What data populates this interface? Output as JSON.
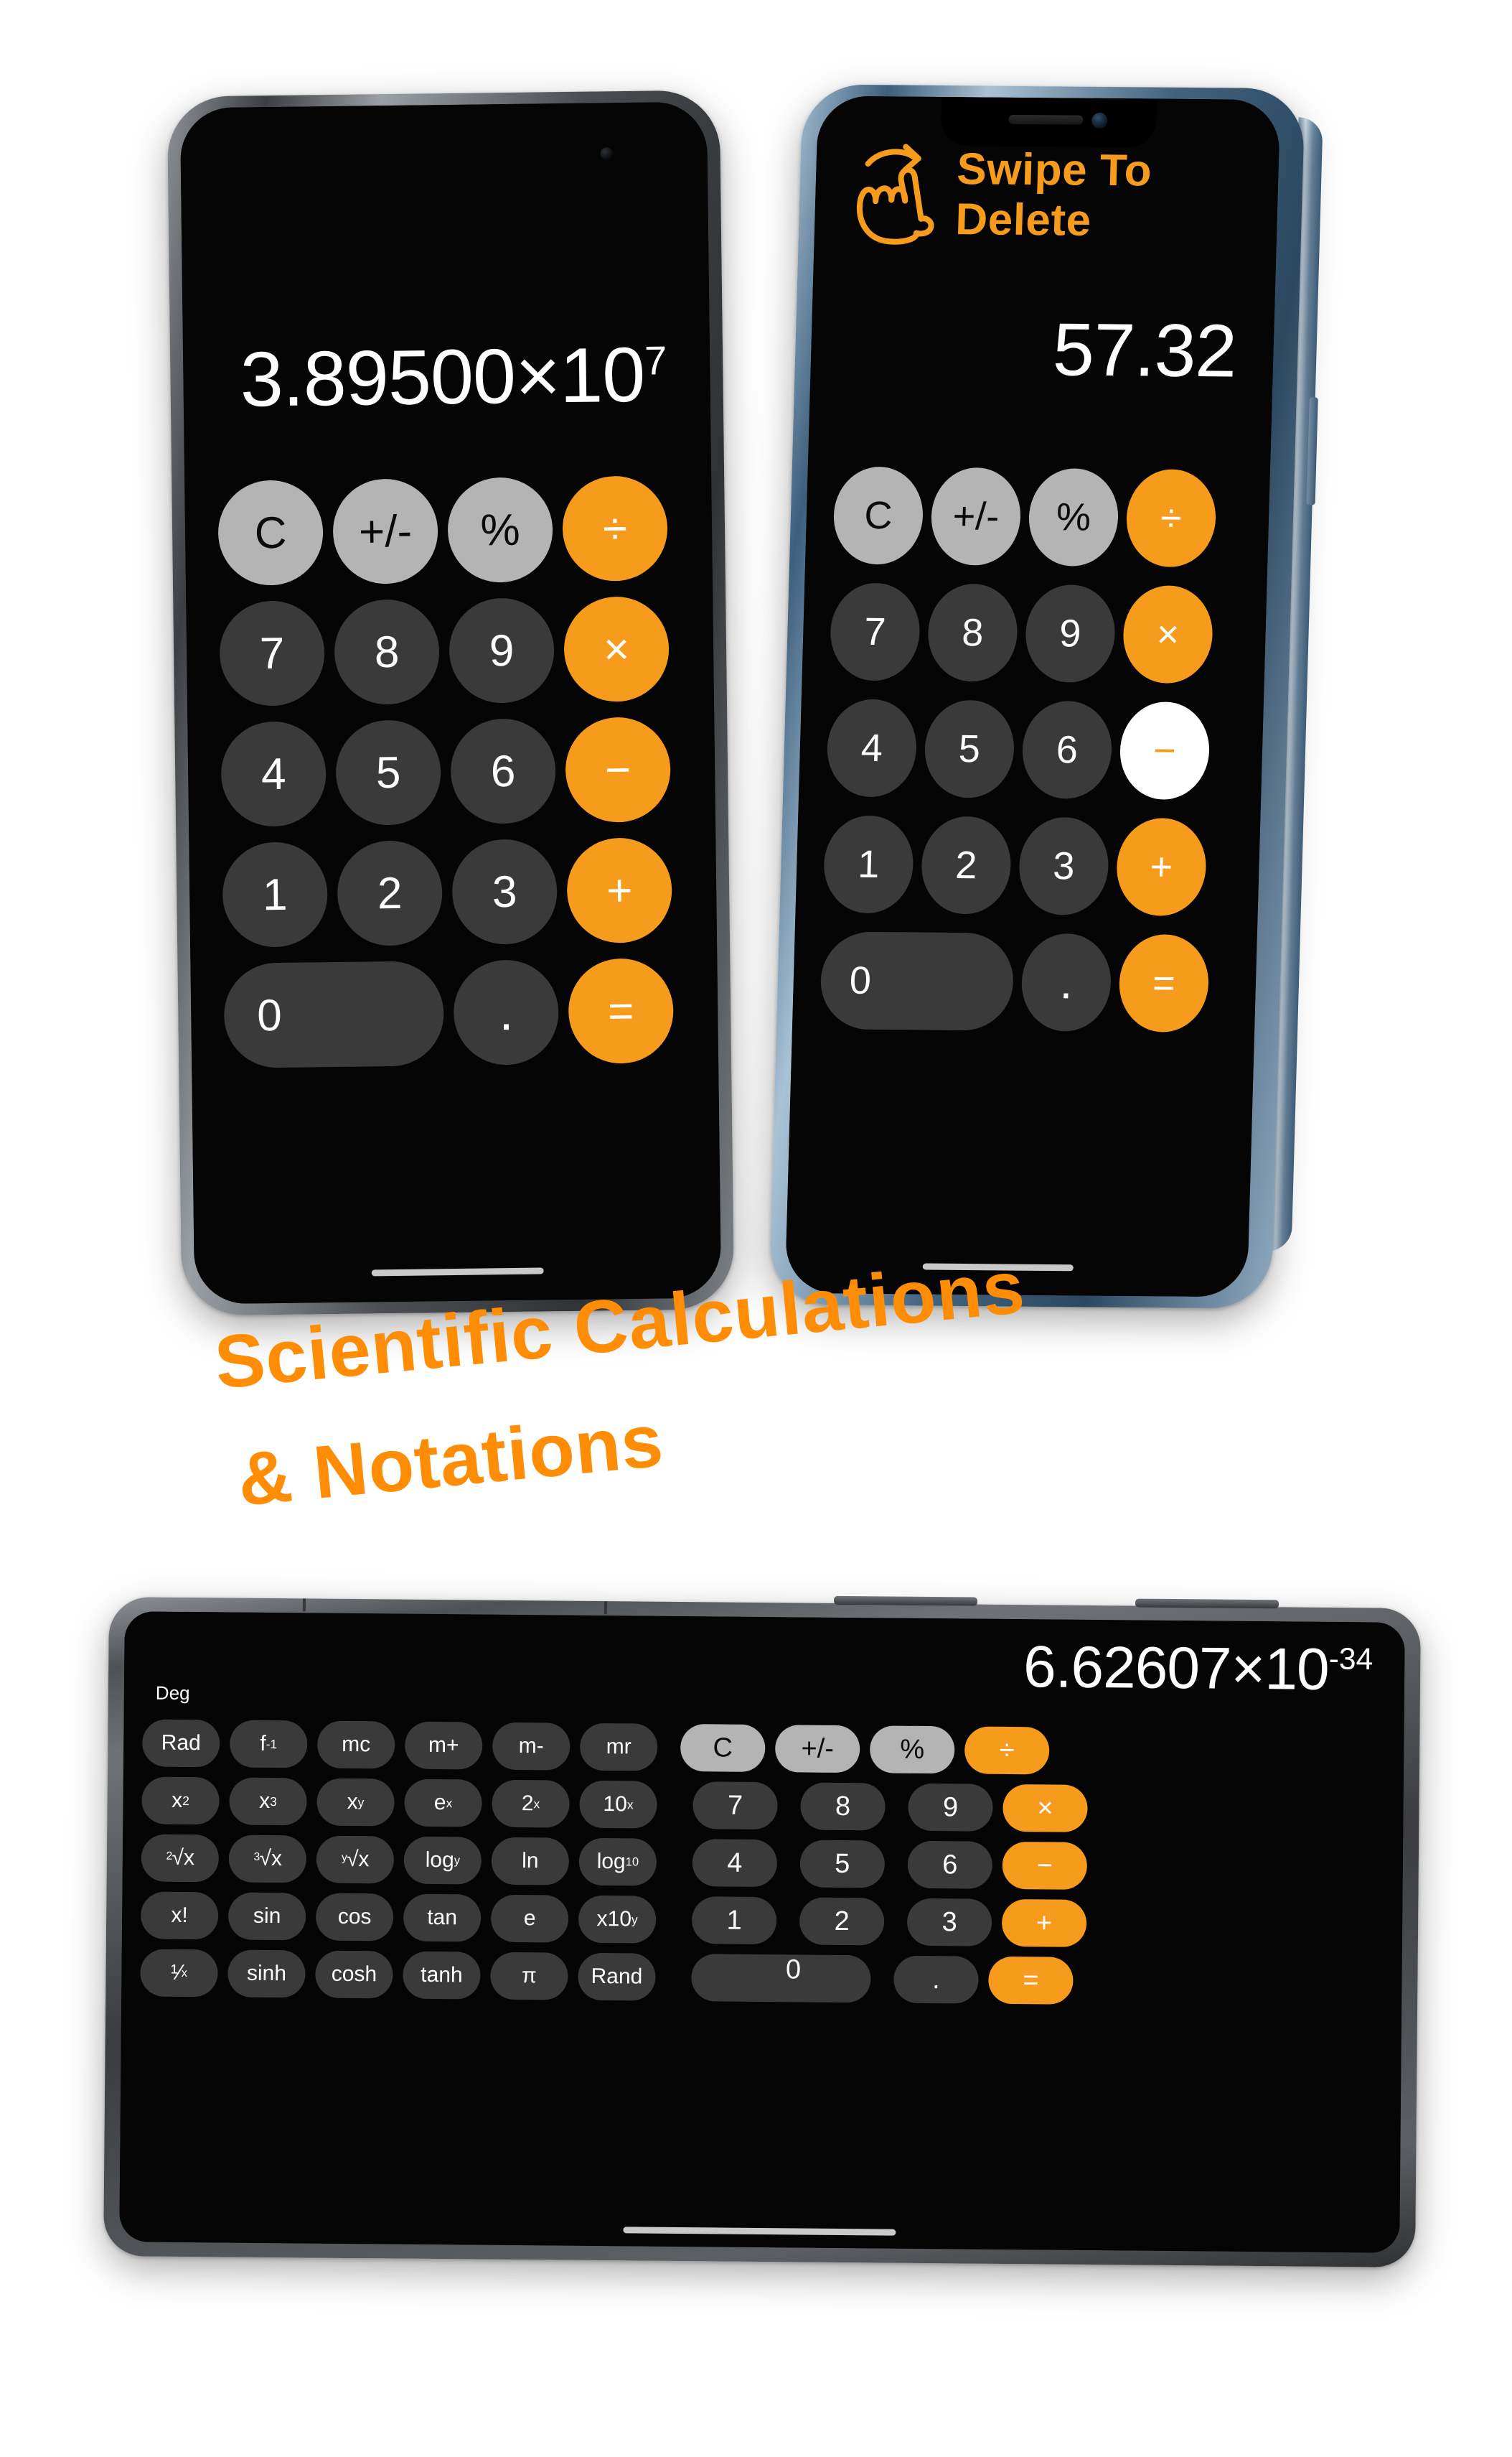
{
  "page": {
    "background_color": "#ffffff",
    "accent_color": "#f79b1c",
    "headline_color": "#ff8c05"
  },
  "headline": {
    "line1": "Scientific Calculations",
    "line2": "& Notations"
  },
  "phone_one": {
    "device": "smartphone-graphite",
    "display_value": "3.89500×10",
    "display_exponent": "7",
    "keys": [
      [
        {
          "label": "C",
          "style": "top"
        },
        {
          "label": "+/-",
          "style": "top"
        },
        {
          "label": "%",
          "style": "top"
        },
        {
          "label": "÷",
          "style": "op"
        }
      ],
      [
        {
          "label": "7",
          "style": "num"
        },
        {
          "label": "8",
          "style": "num"
        },
        {
          "label": "9",
          "style": "num"
        },
        {
          "label": "×",
          "style": "op"
        }
      ],
      [
        {
          "label": "4",
          "style": "num"
        },
        {
          "label": "5",
          "style": "num"
        },
        {
          "label": "6",
          "style": "num"
        },
        {
          "label": "−",
          "style": "op"
        }
      ],
      [
        {
          "label": "1",
          "style": "num"
        },
        {
          "label": "2",
          "style": "num"
        },
        {
          "label": "3",
          "style": "num"
        },
        {
          "label": "+",
          "style": "op"
        }
      ],
      [
        {
          "label": "0",
          "style": "zero"
        },
        {
          "label": ".",
          "style": "dot"
        },
        {
          "label": "=",
          "style": "op"
        }
      ]
    ]
  },
  "phone_two": {
    "device": "smartphone-sierra-blue",
    "banner_text_line1": "Swipe To",
    "banner_text_line2": "Delete",
    "banner_icon": "swipe-hand-icon",
    "display_value": "57.32",
    "active_operator": "−",
    "keys": [
      [
        {
          "label": "C",
          "style": "top"
        },
        {
          "label": "+/-",
          "style": "top"
        },
        {
          "label": "%",
          "style": "top"
        },
        {
          "label": "÷",
          "style": "op"
        }
      ],
      [
        {
          "label": "7",
          "style": "num"
        },
        {
          "label": "8",
          "style": "num"
        },
        {
          "label": "9",
          "style": "num"
        },
        {
          "label": "×",
          "style": "op"
        }
      ],
      [
        {
          "label": "4",
          "style": "num"
        },
        {
          "label": "5",
          "style": "num"
        },
        {
          "label": "6",
          "style": "num"
        },
        {
          "label": "−",
          "style": "op-active"
        }
      ],
      [
        {
          "label": "1",
          "style": "num"
        },
        {
          "label": "2",
          "style": "num"
        },
        {
          "label": "3",
          "style": "num"
        },
        {
          "label": "+",
          "style": "op"
        }
      ],
      [
        {
          "label": "0",
          "style": "zero"
        },
        {
          "label": ".",
          "style": "dot"
        },
        {
          "label": "=",
          "style": "op"
        }
      ]
    ]
  },
  "tablet": {
    "device": "tablet-landscape",
    "angle_mode": "Deg",
    "display_value": "6.62607×10",
    "display_exponent": "-34",
    "scientific_keys": [
      [
        {
          "label": "Rad"
        },
        {
          "label": "f",
          "sup": "-1"
        },
        {
          "label": "mc"
        },
        {
          "label": "m+"
        },
        {
          "label": "m-"
        },
        {
          "label": "mr"
        }
      ],
      [
        {
          "label": "x",
          "sup": "2"
        },
        {
          "label": "x",
          "sup": "3"
        },
        {
          "label": "x",
          "sup": "y"
        },
        {
          "label": "e",
          "sup": "x"
        },
        {
          "label": "2",
          "sup": "x"
        },
        {
          "label": "10",
          "sup": "x"
        }
      ],
      [
        {
          "root_index": "2",
          "root_body": "x"
        },
        {
          "root_index": "3",
          "root_body": "x"
        },
        {
          "root_index": "y",
          "root_body": "x"
        },
        {
          "label": "log",
          "sub": "y"
        },
        {
          "label": "ln"
        },
        {
          "label": "log",
          "sub": "10"
        }
      ],
      [
        {
          "label": "x!"
        },
        {
          "label": "sin"
        },
        {
          "label": "cos"
        },
        {
          "label": "tan"
        },
        {
          "label": "e"
        },
        {
          "label": "x10",
          "sup": "y"
        }
      ],
      [
        {
          "label": "¹⁄",
          "sub": "x"
        },
        {
          "label": "sinh"
        },
        {
          "label": "cosh"
        },
        {
          "label": "tanh"
        },
        {
          "label": "π"
        },
        {
          "label": "Rand"
        }
      ]
    ],
    "numeric_keys": [
      [
        {
          "label": "C",
          "style": "top"
        },
        {
          "label": "+/-",
          "style": "top"
        },
        {
          "label": "%",
          "style": "top"
        },
        {
          "label": "÷",
          "style": "op"
        }
      ],
      [
        {
          "label": "7",
          "style": "num"
        },
        {
          "label": "8",
          "style": "num"
        },
        {
          "label": "9",
          "style": "num"
        },
        {
          "label": "×",
          "style": "op"
        }
      ],
      [
        {
          "label": "4",
          "style": "num"
        },
        {
          "label": "5",
          "style": "num"
        },
        {
          "label": "6",
          "style": "num"
        },
        {
          "label": "−",
          "style": "op"
        }
      ],
      [
        {
          "label": "1",
          "style": "num"
        },
        {
          "label": "2",
          "style": "num"
        },
        {
          "label": "3",
          "style": "num"
        },
        {
          "label": "+",
          "style": "op"
        }
      ],
      [
        {
          "label": "0",
          "style": "zero"
        },
        {
          "label": ".",
          "style": "dot"
        },
        {
          "label": "=",
          "style": "op"
        }
      ]
    ]
  }
}
